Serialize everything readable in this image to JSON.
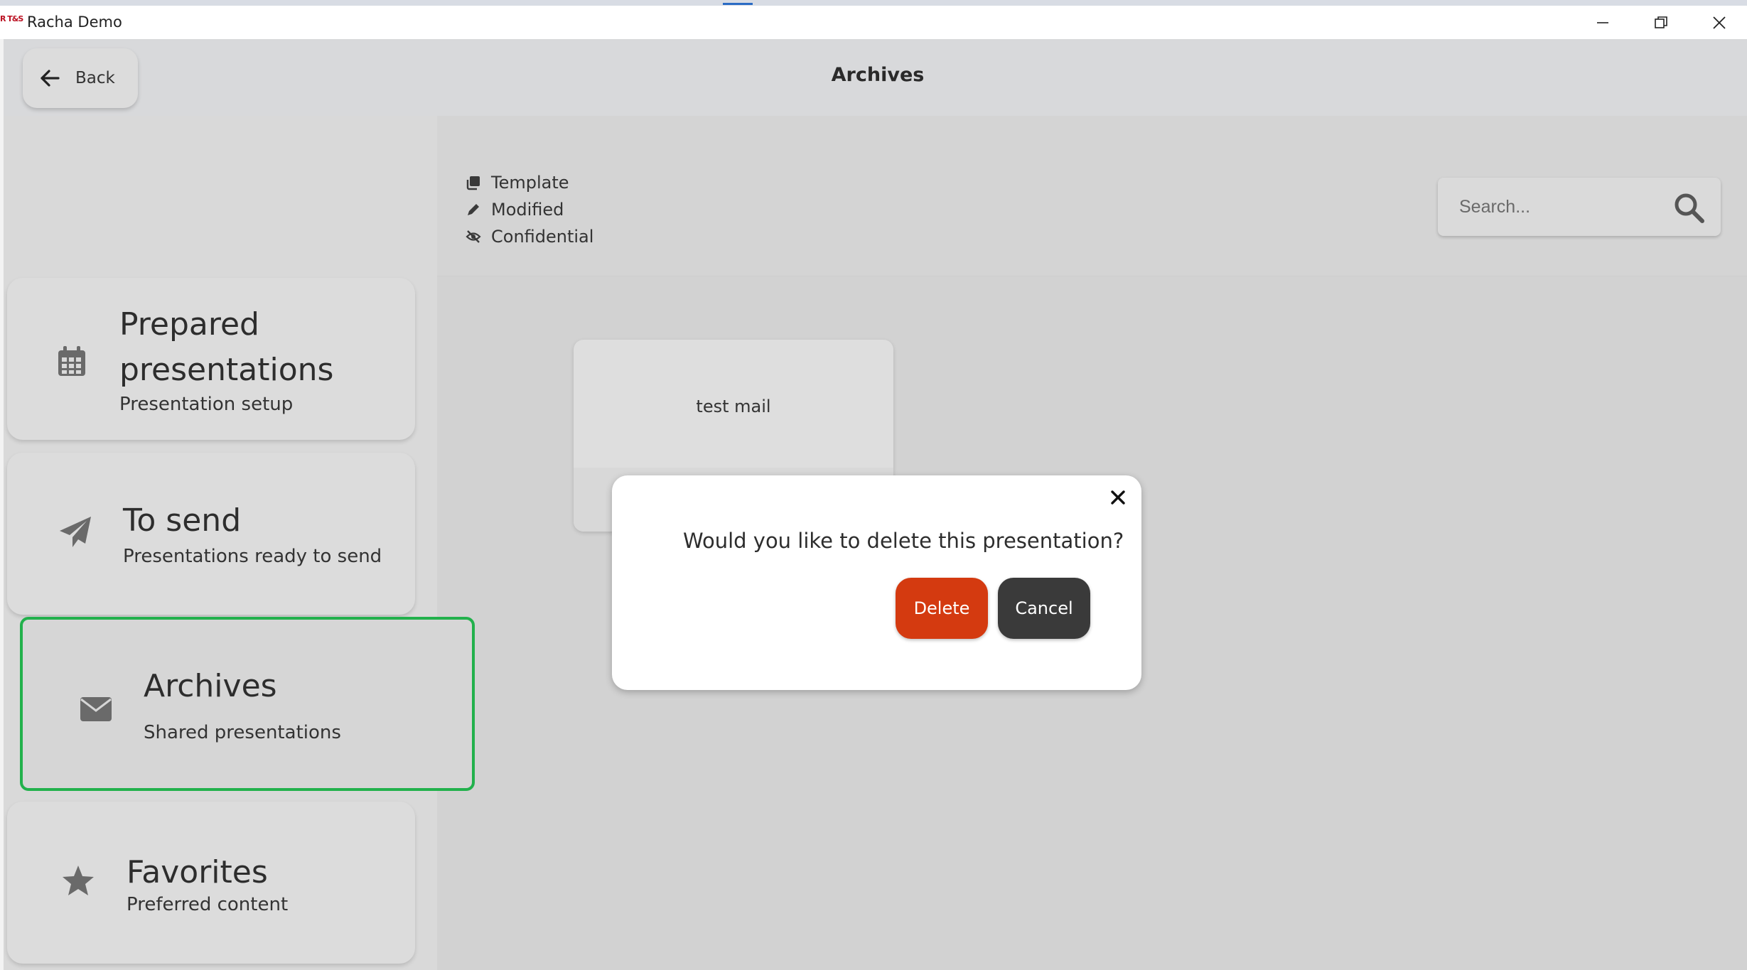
{
  "window": {
    "logo_text": "R T&S",
    "title": "Racha Demo"
  },
  "header": {
    "back_label": "Back",
    "page_title": "Archives"
  },
  "legend": [
    {
      "icon": "template-icon",
      "label": "Template"
    },
    {
      "icon": "pencil-icon",
      "label": "Modified"
    },
    {
      "icon": "eye-slash-icon",
      "label": "Confidential"
    }
  ],
  "search": {
    "placeholder": "Search...",
    "value": ""
  },
  "sidebar": {
    "items": [
      {
        "icon": "calendar-icon",
        "title": "Prepared presentations",
        "subtitle": "Presentation setup",
        "active": false
      },
      {
        "icon": "paper-plane-icon",
        "title": "To send",
        "subtitle": "Presentations ready to send",
        "active": false
      },
      {
        "icon": "envelope-icon",
        "title": "Archives",
        "subtitle": "Shared presentations",
        "active": true
      },
      {
        "icon": "star-icon",
        "title": "Favorites",
        "subtitle": "Preferred content",
        "active": false
      }
    ]
  },
  "content": {
    "tiles": [
      {
        "name": "test mail"
      }
    ]
  },
  "dialog": {
    "message": "Would you like to delete this presentation?",
    "delete_label": "Delete",
    "cancel_label": "Cancel"
  },
  "colors": {
    "delete": "#d43a10",
    "cancel": "#3a3a3a",
    "active_border": "#22b14c"
  }
}
